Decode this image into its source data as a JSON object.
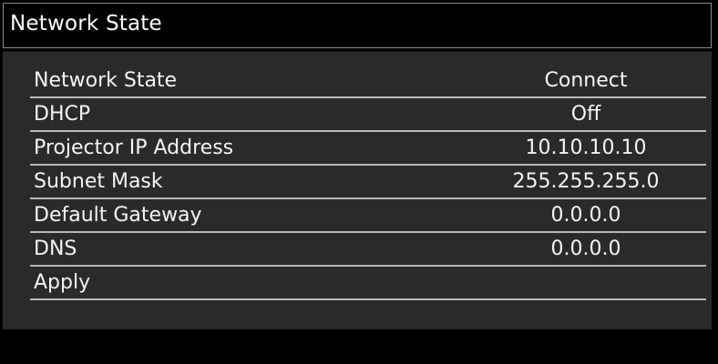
{
  "window": {
    "title": "Network State"
  },
  "menu": {
    "rows": [
      {
        "label": "Network State",
        "value": "Connect"
      },
      {
        "label": "DHCP",
        "value": "Off"
      },
      {
        "label": "Projector IP Address",
        "value": "10.10.10.10"
      },
      {
        "label": "Subnet Mask",
        "value": "255.255.255.0"
      },
      {
        "label": "Default Gateway",
        "value": "0.0.0.0"
      },
      {
        "label": "DNS",
        "value": "0.0.0.0"
      },
      {
        "label": "Apply",
        "value": ""
      }
    ]
  },
  "colors": {
    "panel_background": "#2a2a2a",
    "title_background": "#000000",
    "text": "#f4f4f4",
    "divider": "#b9b9b9"
  }
}
